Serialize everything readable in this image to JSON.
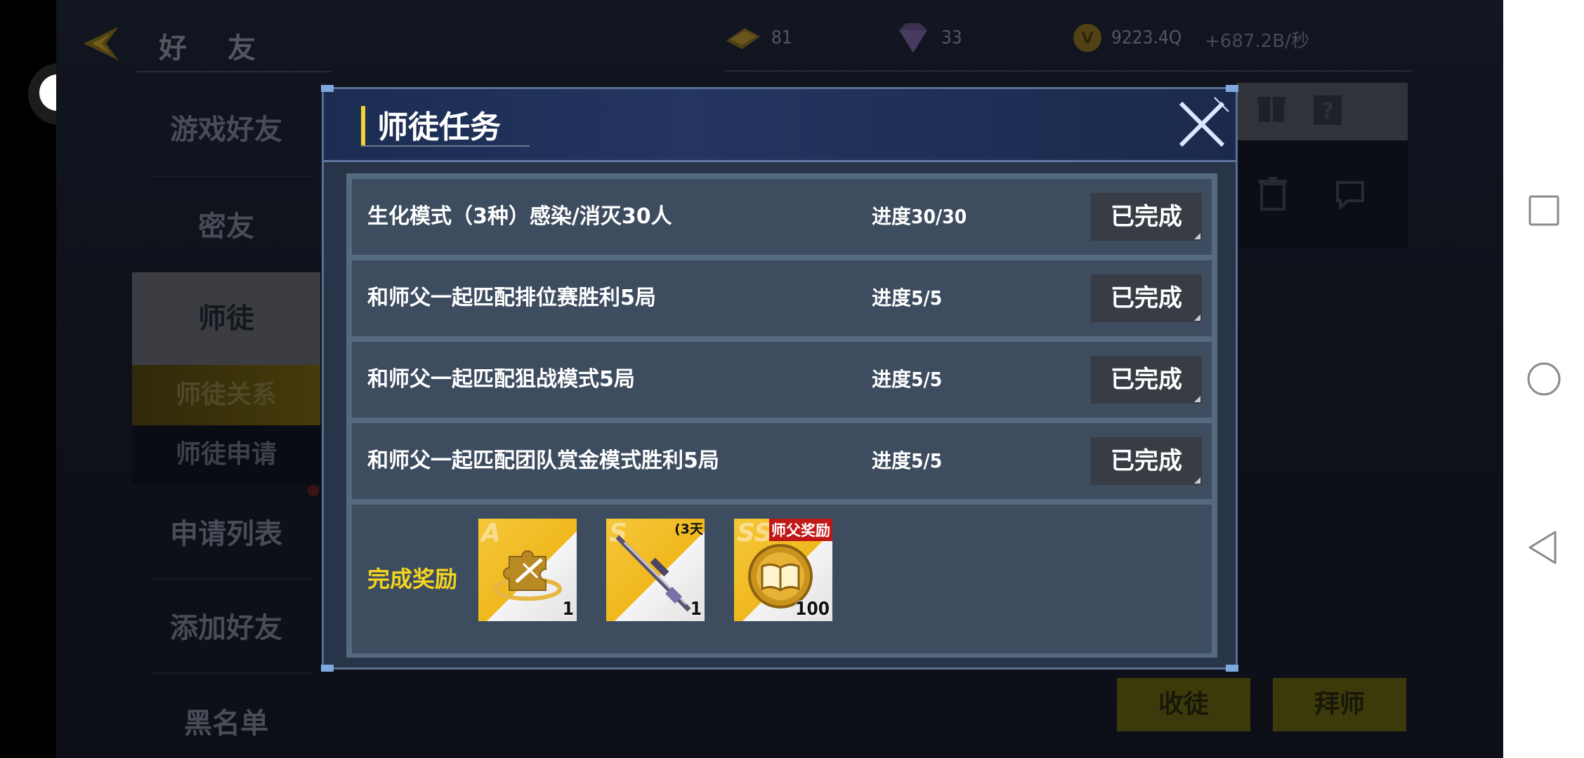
{
  "header": {
    "title": "好 友",
    "currencies": [
      {
        "icon": "gold-bar-icon",
        "value": "81"
      },
      {
        "icon": "diamond-icon",
        "value": "33"
      },
      {
        "icon": "v-coin-icon",
        "value": "9223.4Q"
      }
    ],
    "rate": "+687.2B/秒"
  },
  "sidebar": {
    "items": [
      {
        "label": "游戏好友"
      },
      {
        "label": "密友"
      },
      {
        "label": "师徒"
      },
      {
        "label": "申请列表"
      },
      {
        "label": "添加好友"
      },
      {
        "label": "黑名单"
      }
    ],
    "sub_items": [
      {
        "label": "师徒关系"
      },
      {
        "label": "师徒申请"
      }
    ]
  },
  "bottom_buttons": {
    "recruit": "收徒",
    "apprentice": "拜师"
  },
  "modal": {
    "title": "师徒任务",
    "tasks": [
      {
        "text": "生化模式（3种）感染/消灭30人",
        "progress": "进度30/30",
        "status": "已完成"
      },
      {
        "text": "和师父一起匹配排位赛胜利5局",
        "progress": "进度5/5",
        "status": "已完成"
      },
      {
        "text": "和师父一起匹配狙战模式5局",
        "progress": "进度5/5",
        "status": "已完成"
      },
      {
        "text": "和师父一起匹配团队赏金模式胜利5局",
        "progress": "进度5/5",
        "status": "已完成"
      }
    ],
    "reward_label": "完成奖励",
    "rewards": [
      {
        "grade": "A",
        "icon": "puzzle-weapon-fragment-icon",
        "count": "1"
      },
      {
        "grade": "S",
        "icon": "sniper-rifle-icon",
        "count": "1",
        "duration": "(3天"
      },
      {
        "grade": "SS",
        "icon": "master-book-coin-icon",
        "count": "100",
        "tag": "师父奖励"
      }
    ]
  },
  "colors": {
    "accent_yellow": "#f3d51f",
    "modal_bg": "#283447",
    "row_bg": "#3d4c5f",
    "reward_red": "#c01818"
  }
}
